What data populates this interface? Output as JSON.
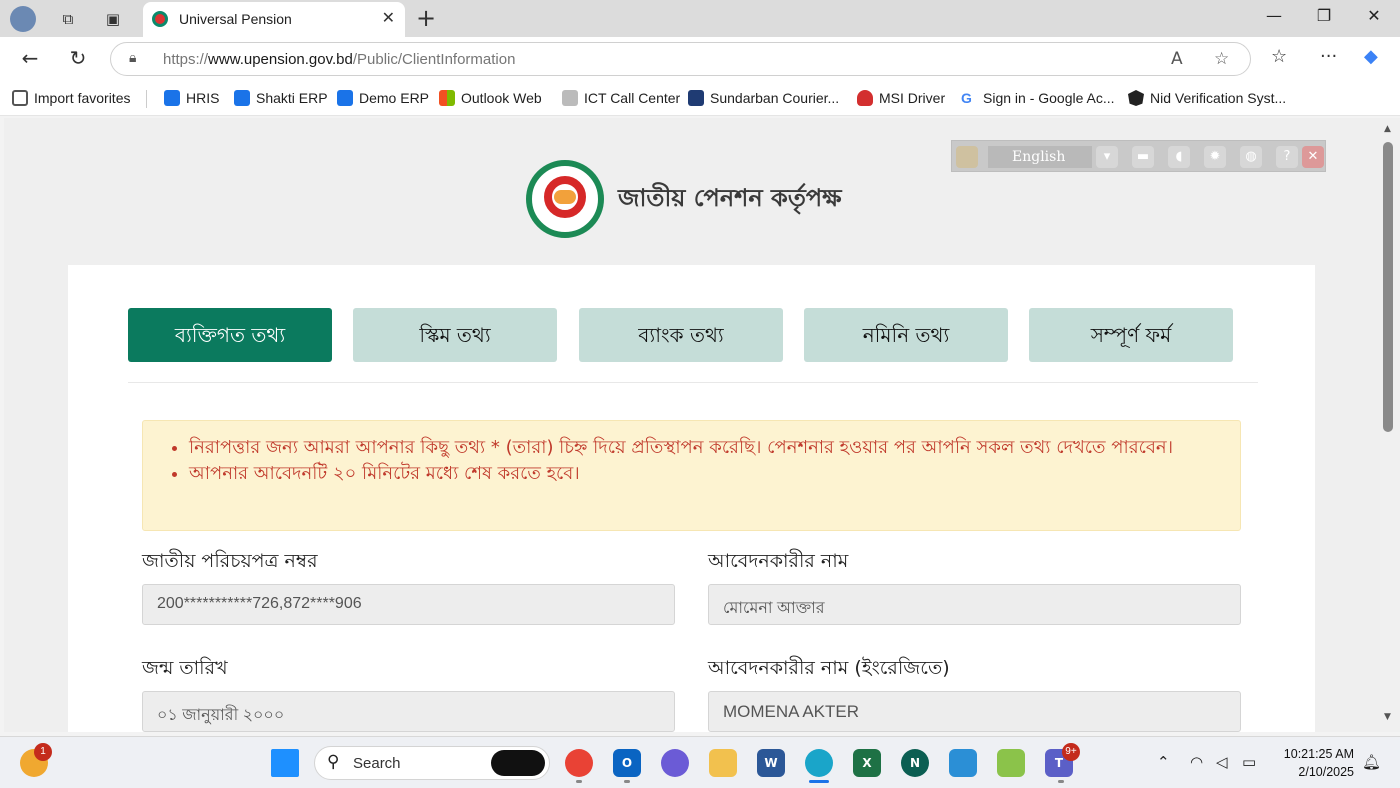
{
  "browser": {
    "tab_title": "Universal Pension",
    "url_prefix": "https://",
    "url_host": "www.upension.gov.bd",
    "url_path": "/Public/ClientInformation"
  },
  "favorites": [
    {
      "label": "Import favorites",
      "color": "#555555"
    },
    {
      "label": "HRIS",
      "color": "#1a73e8"
    },
    {
      "label": "Shakti ERP",
      "color": "#1a73e8"
    },
    {
      "label": "Demo ERP",
      "color": "#1a73e8"
    },
    {
      "label": "Outlook Web",
      "color": "#f25022"
    },
    {
      "label": "ICT Call Center",
      "color": "#999999"
    },
    {
      "label": "Sundarban Courier...",
      "color": "#1f3b73"
    },
    {
      "label": "MSI Driver",
      "color": "#d32f2f"
    },
    {
      "label": "Sign in - Google Ac...",
      "color": "#4285f4"
    },
    {
      "label": "Nid Verification Syst...",
      "color": "#222222"
    }
  ],
  "translate_widget": {
    "language": "English"
  },
  "org": {
    "title": "জাতীয় পেনশন কর্তৃপক্ষ"
  },
  "tabs": [
    {
      "label": "ব্যক্তিগত তথ্য",
      "active": true
    },
    {
      "label": "স্কিম তথ্য",
      "active": false
    },
    {
      "label": "ব্যাংক তথ্য",
      "active": false
    },
    {
      "label": "নমিনি তথ্য",
      "active": false
    },
    {
      "label": "সম্পূর্ণ ফর্ম",
      "active": false
    }
  ],
  "alert": {
    "line1": "নিরাপত্তার জন্য আমরা আপনার কিছু তথ্য * (তারা) চিহ্ন দিয়ে প্রতিস্থাপন করেছি। পেনশনার হওয়ার পর আপনি সকল তথ্য দেখতে পারবেন।",
    "line2": "আপনার আবেদনটি ২০ মিনিটের মধ্যে শেষ করতে হবে।"
  },
  "form": {
    "nid_label": "জাতীয় পরিচয়পত্র নম্বর",
    "nid_value": "200***********726,872****906",
    "name_label": "আবেদনকারীর নাম",
    "name_value": "মোমেনা আক্তার",
    "dob_label": "জন্ম তারিখ",
    "dob_value": "০১ জানুয়ারী ২০০০",
    "name_en_label": "আবেদনকারীর নাম (ইংরেজিতে)",
    "name_en_value": "MOMENA AKTER"
  },
  "taskbar": {
    "search_label": "Search",
    "widget_badge": "1",
    "teams_badge": "9+",
    "time": "10:21:25 AM",
    "date": "2/10/2025"
  },
  "colors": {
    "active_tab": "#0b7a5e",
    "inactive_tab": "#c5ddd8",
    "alert_text": "#c0392b",
    "alert_bg": "#fdf3d1"
  }
}
